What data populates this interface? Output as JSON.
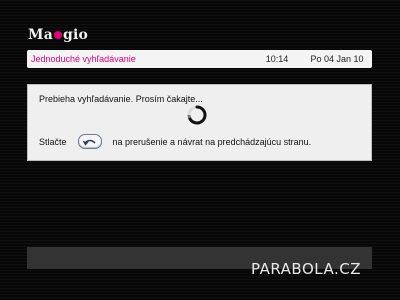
{
  "logo": {
    "text_before": "Ma",
    "text_after": "gio",
    "dot_color": "#e0007a"
  },
  "header": {
    "title": "Jednoduché vyhľadávanie",
    "time": "10:14",
    "date": "Po 04 Jan 10"
  },
  "dialog": {
    "message": "Prebieha vyhľadávanie. Prosím čakajte...",
    "hint_prefix": "Stlačte",
    "hint_button_icon": "back-arrow-icon",
    "hint_suffix": "na prerušenie a návrat na predchádzajúcu stranu."
  },
  "watermark": "PARABOLA.CZ",
  "colors": {
    "accent": "#e0007a",
    "panel": "#efefef",
    "background": "#0b0b0b"
  }
}
